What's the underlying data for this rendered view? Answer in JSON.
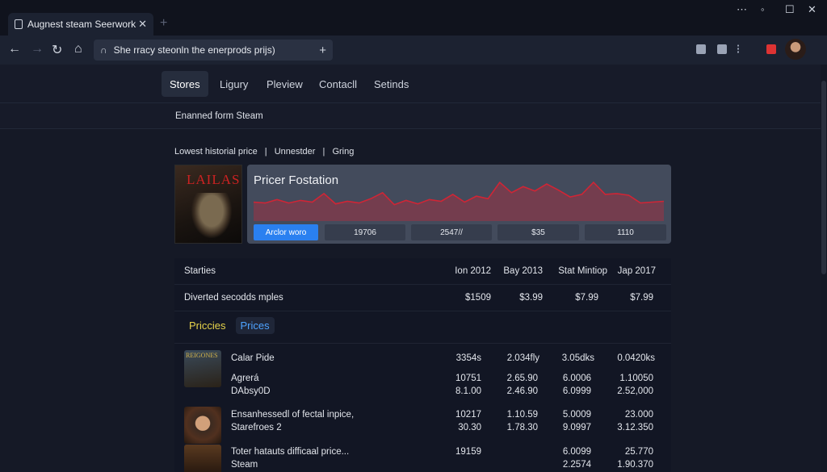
{
  "browser": {
    "tab_title": "Augnest steam Seerwork",
    "tab_close": "✕",
    "new_tab": "+",
    "window_controls": [
      "⋯",
      "◦",
      "☐",
      "✕"
    ],
    "nav": {
      "back": "←",
      "forward": "→",
      "reload": "↻",
      "home": "⌂"
    },
    "address": "She rracy steonln the enerprods prijs)",
    "address_plus": "+"
  },
  "subnav": {
    "items": [
      "Stores",
      "Ligury",
      "Pleview",
      "Contacll",
      "Setinds"
    ],
    "active": "Stores"
  },
  "section_label": "Enanned form Steam",
  "filters": [
    "Lowest historial price",
    "|",
    "Unnestder",
    "|",
    "Gring"
  ],
  "game": {
    "cover_title": "LAILAS"
  },
  "chart_data": {
    "type": "area",
    "title": "Pricer Fostation",
    "values": [
      22,
      21,
      25,
      21,
      24,
      22,
      32,
      20,
      23,
      21,
      26,
      33,
      19,
      24,
      20,
      25,
      23,
      31,
      22,
      29,
      26,
      45,
      33,
      40,
      35,
      43,
      36,
      28,
      31,
      45,
      31,
      32,
      30,
      21,
      22,
      23
    ],
    "ylim": [
      0,
      60
    ],
    "color": "#d02535",
    "stats": [
      "Arclor woro",
      "19706",
      "2547//",
      "$35",
      "1110"
    ]
  },
  "table": {
    "header": [
      "Starties",
      "Ion 2012",
      "Bay 2013",
      "Stat Mintiop",
      "Jap 2017"
    ],
    "row1": [
      "Diverted secodds mples",
      "$1509",
      "$3.99",
      "$7.99",
      "$7.99"
    ],
    "pills": [
      "Priccies",
      "Prices"
    ],
    "games": [
      {
        "thumb_label": "REIGONES",
        "lines": [
          "Calar Pide",
          "Agrerá",
          "DAbsy0D"
        ],
        "cols": [
          [
            "3354s",
            "10751",
            "8.1.00"
          ],
          [
            "2.034fly",
            "2.65.90",
            "2.46.90"
          ],
          [
            "3.05dks",
            "6.0006",
            "6.0999"
          ],
          [
            "0.0420ks",
            "1.10050",
            "2.52,000"
          ]
        ]
      },
      {
        "thumb_label": "",
        "lines": [
          "Ensanhessedl of fectal inpice,",
          "Starefroes 2"
        ],
        "cols": [
          [
            "10217",
            "30.30"
          ],
          [
            "1.10.59",
            "1.78.30"
          ],
          [
            "5.0009",
            "9.0997"
          ],
          [
            "23.000",
            "3.12.350"
          ]
        ]
      },
      {
        "thumb_label": "",
        "lines": [
          "Toter hatauts difficaal price...",
          "Steam"
        ],
        "cols": [
          [
            "19159"
          ],
          [
            "",
            ""
          ],
          [
            "6.0099",
            "2.2574"
          ],
          [
            "25.770",
            "1.90.370"
          ]
        ]
      }
    ]
  }
}
